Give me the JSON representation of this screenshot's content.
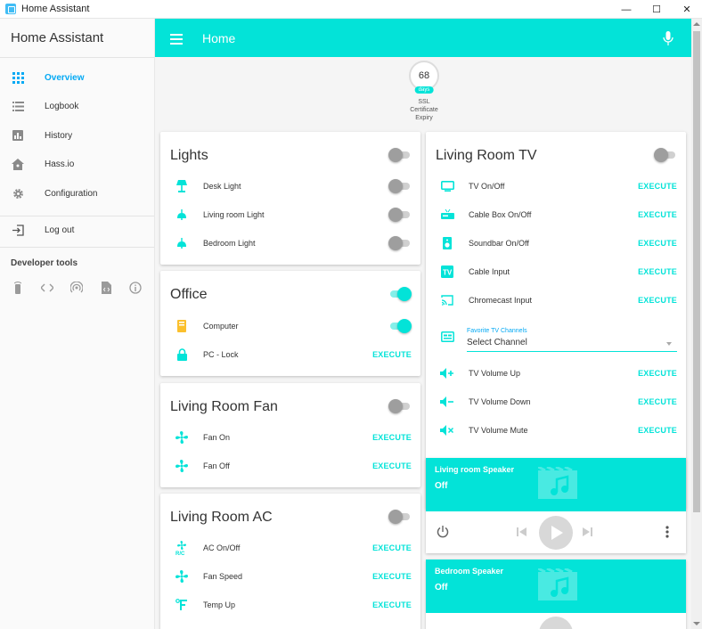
{
  "window": {
    "title": "Home Assistant"
  },
  "colors": {
    "accent": "#03e3d8",
    "active_nav": "#03a9f4"
  },
  "sidebar": {
    "title": "Home Assistant",
    "items": [
      {
        "label": "Overview",
        "icon": "grid-icon"
      },
      {
        "label": "Logbook",
        "icon": "list-icon"
      },
      {
        "label": "History",
        "icon": "chart-icon"
      },
      {
        "label": "Hass.io",
        "icon": "home-assistant-icon"
      },
      {
        "label": "Configuration",
        "icon": "gear-icon"
      }
    ],
    "logout": "Log out",
    "developer_tools": "Developer tools"
  },
  "toolbar": {
    "title": "Home"
  },
  "badge": {
    "value": "68",
    "unit": "days",
    "label_line1": "SSL",
    "label_line2": "Certificate",
    "label_line3": "Expiry"
  },
  "cards": {
    "lights": {
      "title": "Lights",
      "header_toggle": "off",
      "rows": [
        {
          "name": "Desk Light",
          "state": "off"
        },
        {
          "name": "Living room Light",
          "state": "off"
        },
        {
          "name": "Bedroom Light",
          "state": "off"
        }
      ]
    },
    "office": {
      "title": "Office",
      "header_toggle": "on",
      "rows": [
        {
          "name": "Computer",
          "state": "on"
        },
        {
          "name": "PC - Lock",
          "action": "EXECUTE"
        }
      ]
    },
    "fan": {
      "title": "Living Room Fan",
      "header_toggle": "off",
      "rows": [
        {
          "name": "Fan On",
          "action": "EXECUTE"
        },
        {
          "name": "Fan Off",
          "action": "EXECUTE"
        }
      ]
    },
    "ac": {
      "title": "Living Room AC",
      "header_toggle": "off",
      "rows": [
        {
          "name": "AC On/Off",
          "action": "EXECUTE"
        },
        {
          "name": "Fan Speed",
          "action": "EXECUTE"
        },
        {
          "name": "Temp Up",
          "action": "EXECUTE"
        }
      ]
    },
    "tv": {
      "title": "Living Room TV",
      "header_toggle": "off",
      "rows": [
        {
          "name": "TV On/Off",
          "action": "EXECUTE"
        },
        {
          "name": "Cable Box On/Off",
          "action": "EXECUTE"
        },
        {
          "name": "Soundbar On/Off",
          "action": "EXECUTE"
        },
        {
          "name": "Cable Input",
          "action": "EXECUTE"
        },
        {
          "name": "Chromecast Input",
          "action": "EXECUTE"
        }
      ],
      "select": {
        "label": "Favorite TV Channels",
        "value": "Select Channel"
      },
      "volume_rows": [
        {
          "name": "TV Volume Up",
          "action": "EXECUTE"
        },
        {
          "name": "TV Volume Down",
          "action": "EXECUTE"
        },
        {
          "name": "TV Volume Mute",
          "action": "EXECUTE"
        }
      ]
    },
    "living_speaker": {
      "name": "Living room Speaker",
      "state": "Off"
    },
    "bedroom_speaker": {
      "name": "Bedroom Speaker",
      "state": "Off"
    }
  }
}
